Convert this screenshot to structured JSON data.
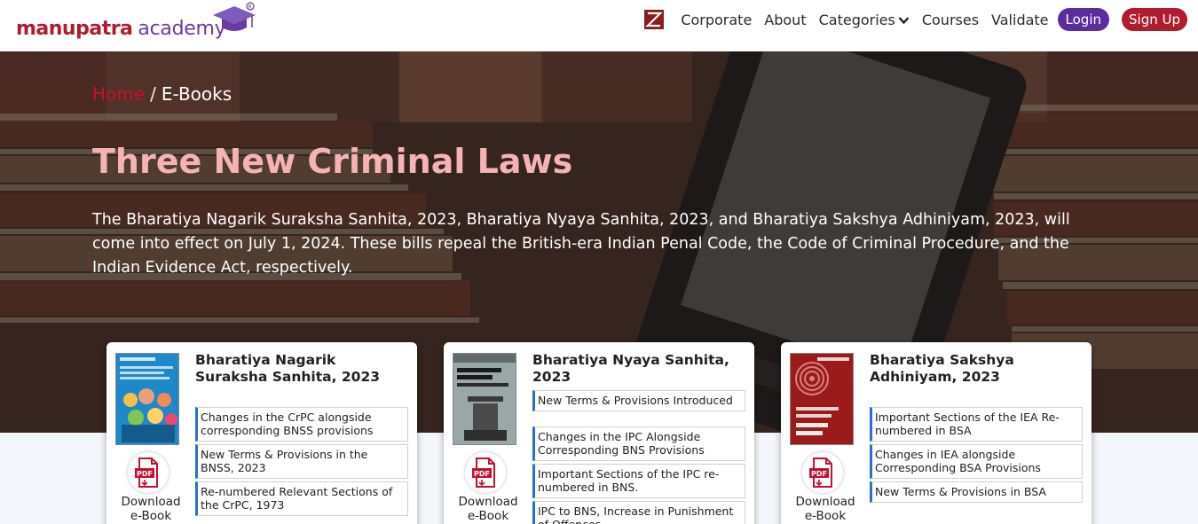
{
  "header": {
    "logo_brand": "manupatra",
    "logo_academy": "academy",
    "nav": {
      "corporate": "Corporate",
      "about": "About",
      "categories": "Categories",
      "courses": "Courses",
      "validate": "Validate",
      "login": "Login",
      "signup": "Sign Up"
    }
  },
  "hero": {
    "breadcrumb": {
      "home": "Home",
      "separator": "/",
      "current": "E-Books"
    },
    "title": "Three New Criminal Laws",
    "description": "The Bharatiya Nagarik Suraksha Sanhita, 2023, Bharatiya Nyaya Sanhita, 2023, and Bharatiya Sakshya Adhiniyam, 2023, will come into effect on July 1, 2024. These bills repeal the British-era Indian Penal Code, the Code of Criminal Procedure, and the Indian Evidence Act, respectively."
  },
  "cards": [
    {
      "title": "Bharatiya Nagarik Suraksha Sanhita, 2023",
      "download_label": "Download e-Book",
      "links": [
        "Changes in the CrPC alongside corresponding BNSS provisions",
        "New Terms & Provisions in the BNSS, 2023",
        "Re-numbered Relevant Sections of the CrPC, 1973"
      ]
    },
    {
      "title": "Bharatiya Nyaya Sanhita, 2023",
      "download_label": "Download e-Book",
      "links": [
        "New Terms & Provisions Introduced",
        "Changes in the IPC Alongside Corresponding BNS Provisions",
        "Important Sections of the IPC re-numbered in BNS.",
        "IPC to BNS, Increase in Punishment of Offences"
      ]
    },
    {
      "title": "Bharatiya Sakshya Adhiniyam, 2023",
      "download_label": "Download e-Book",
      "links": [
        "Important Sections of the IEA Re-numbered in BSA",
        "Changes in IEA alongside Corresponding BSA Provisions",
        "New Terms & Provisions in BSA"
      ]
    }
  ],
  "colors": {
    "brand_red": "#b01c2e",
    "brand_purple": "#5b2ba0",
    "title_pink": "#f5b3b3",
    "link_accent": "#2a6fd1"
  },
  "icons": {
    "corporate": "z-square-icon",
    "categories": "chevron-down-icon",
    "download": "pdf-file-icon",
    "logo": "graduation-cap-icon"
  }
}
